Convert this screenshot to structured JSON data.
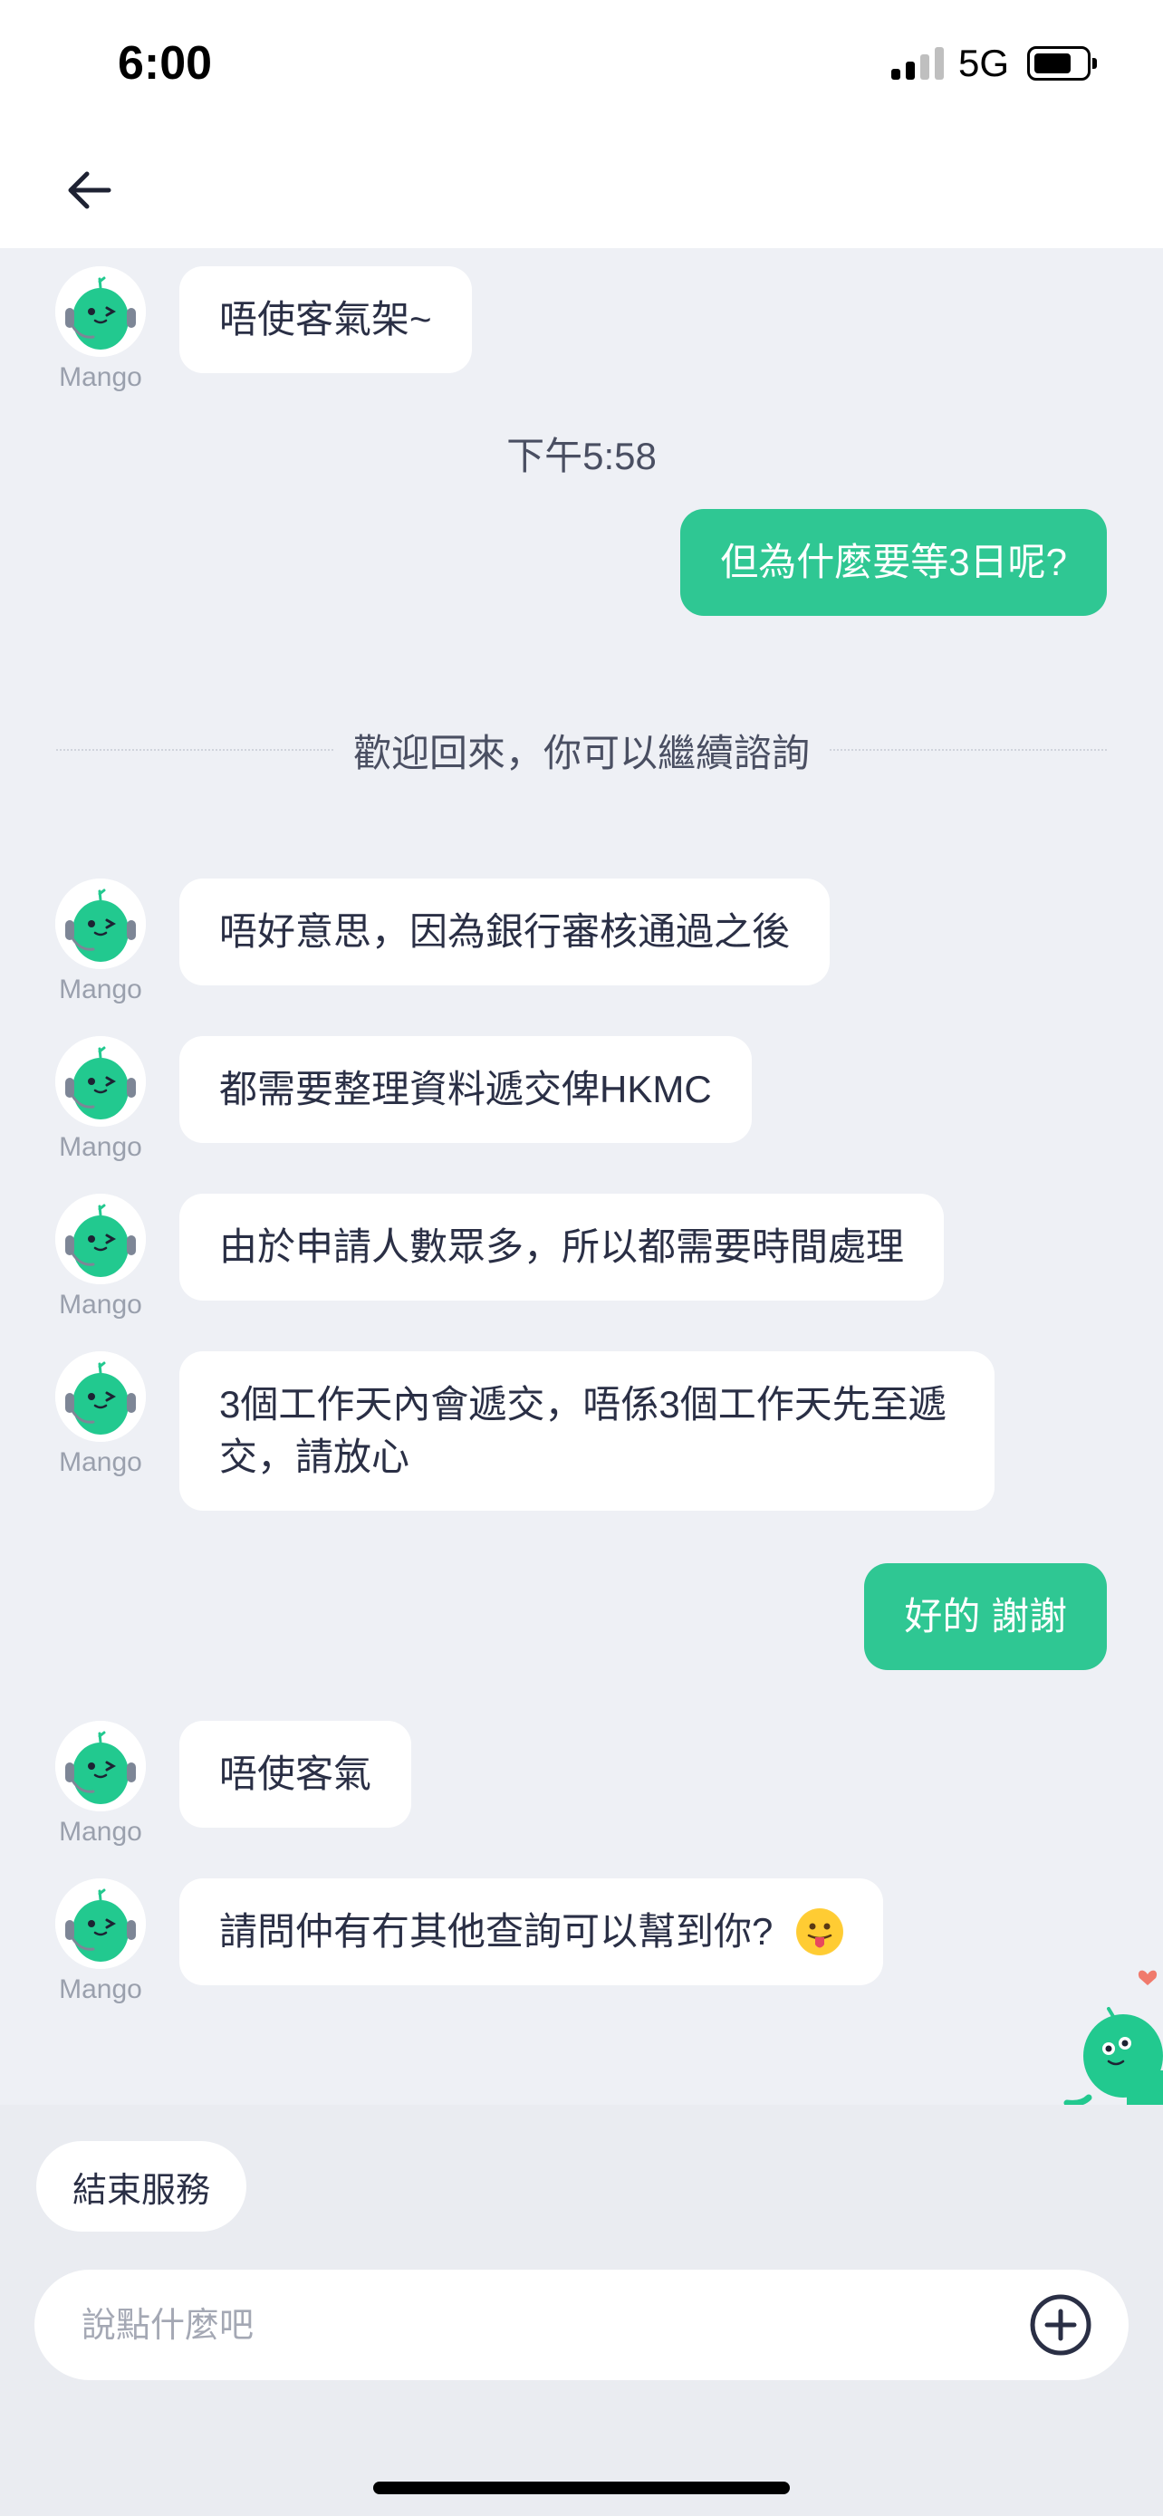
{
  "status_bar": {
    "time": "6:00",
    "network": "5G"
  },
  "chat": {
    "bot_name": "Mango",
    "messages": [
      {
        "sender": "bot",
        "text": "唔使客氣架~"
      },
      {
        "type": "timestamp",
        "text": "下午5:58"
      },
      {
        "sender": "user",
        "text": "但為什麼要等3日呢?"
      },
      {
        "type": "system",
        "text": "歡迎回來，你可以繼續諮詢"
      },
      {
        "sender": "bot",
        "text": "唔好意思，因為銀行審核通過之後"
      },
      {
        "sender": "bot",
        "text": "都需要整理資料遞交俾HKMC"
      },
      {
        "sender": "bot",
        "text": "由於申請人數眾多，所以都需要時間處理"
      },
      {
        "sender": "bot",
        "text": "3個工作天內會遞交，唔係3個工作天先至遞交，請放心"
      },
      {
        "sender": "user",
        "text": "好的 謝謝"
      },
      {
        "sender": "bot",
        "text": "唔使客氣"
      },
      {
        "sender": "bot",
        "text": "請問仲有冇其他查詢可以幫到你?"
      }
    ]
  },
  "bottom": {
    "end_service_label": "結束服務",
    "input_placeholder": "說點什麼吧",
    "input_value": ""
  },
  "colors": {
    "accent": "#2fc793",
    "background": "#eef0f5"
  },
  "icons": [
    "back-arrow-icon",
    "add-circle-icon",
    "bot-avatar-icon",
    "tongue-emoji-icon",
    "mascot-icon"
  ]
}
